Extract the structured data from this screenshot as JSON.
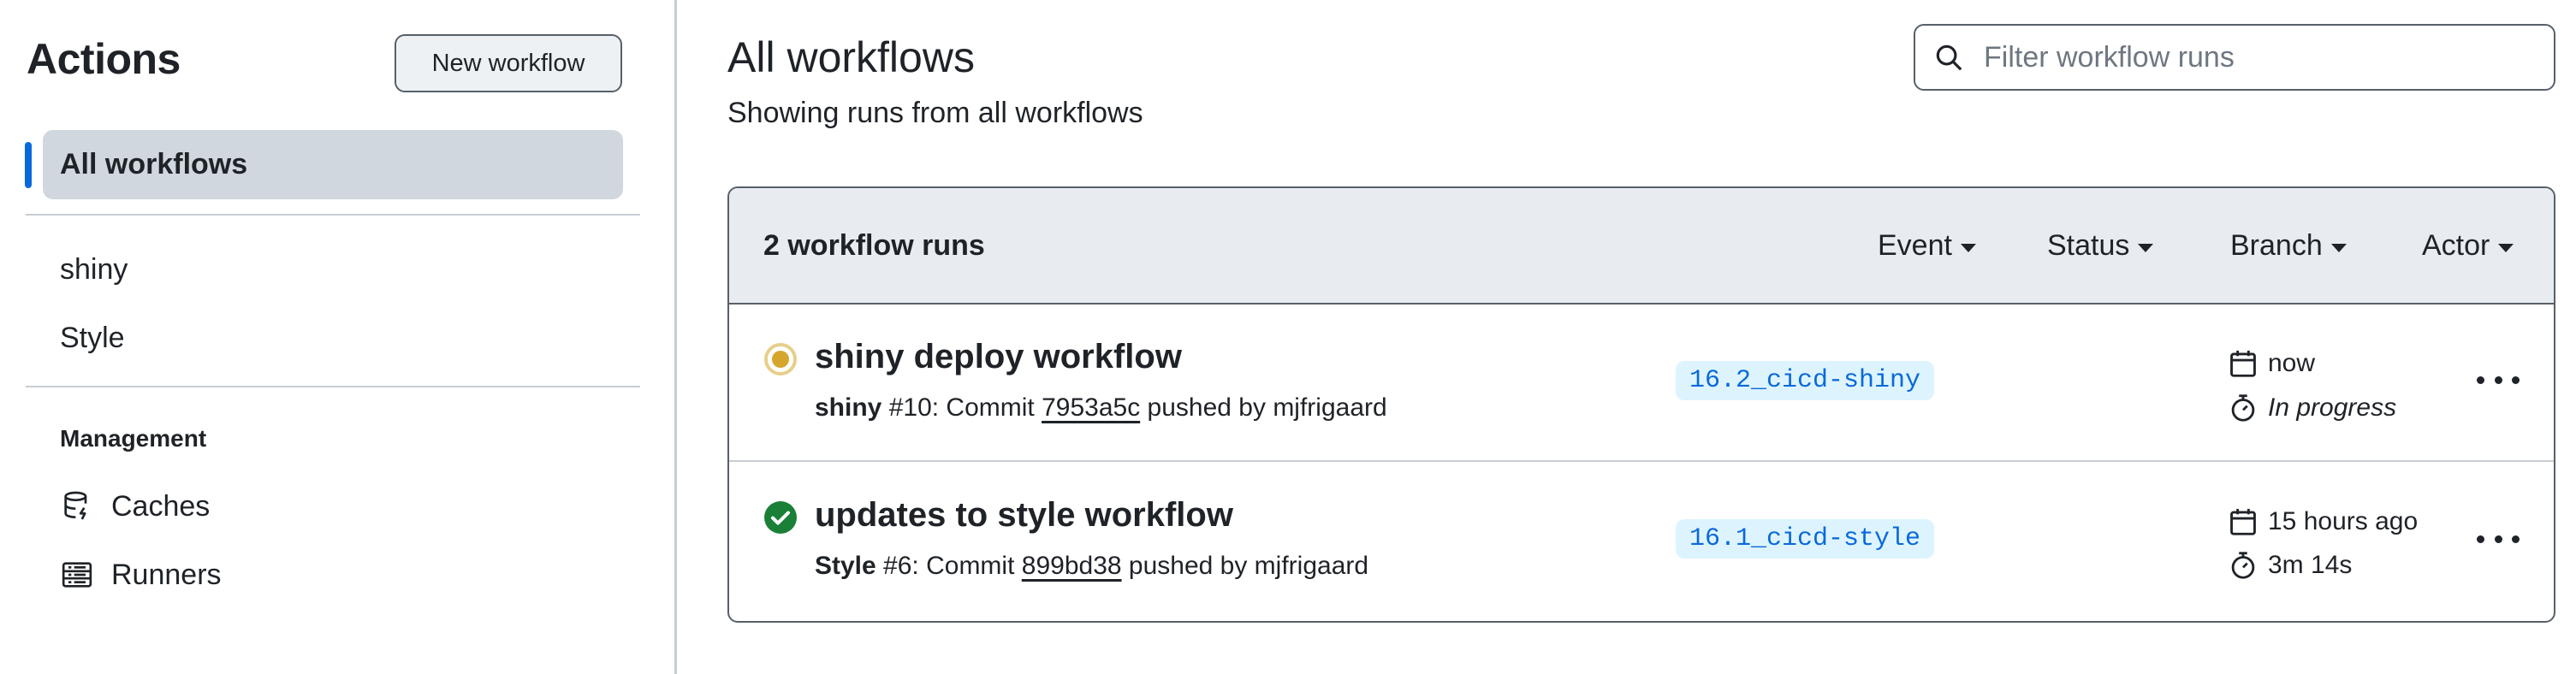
{
  "sidebar": {
    "title": "Actions",
    "new_workflow_label": "New workflow",
    "active_item": "All workflows",
    "workflows": [
      "shiny",
      "Style"
    ],
    "management_label": "Management",
    "management_items": [
      {
        "label": "Caches",
        "icon": "database-icon"
      },
      {
        "label": "Runners",
        "icon": "server-icon"
      }
    ]
  },
  "main": {
    "title": "All workflows",
    "subtitle": "Showing runs from all workflows",
    "search_placeholder": "Filter workflow runs",
    "runs_count": "2 workflow runs",
    "filters": [
      "Event",
      "Status",
      "Branch",
      "Actor"
    ],
    "runs": [
      {
        "status": "in-progress",
        "title": "shiny deploy workflow",
        "workflow": "shiny",
        "meta_mid": " #10: Commit ",
        "sha": "7953a5c",
        "meta_end": " pushed by mjfrigaard",
        "branch": "16.2_cicd-shiny",
        "when": "now",
        "duration": "In progress"
      },
      {
        "status": "success",
        "title": "updates to style workflow",
        "workflow": "Style",
        "meta_mid": " #6: Commit ",
        "sha": "899bd38",
        "meta_end": " pushed by mjfrigaard",
        "branch": "16.1_cicd-style",
        "when": "15 hours ago",
        "duration": "3m 14s"
      }
    ]
  },
  "colors": {
    "accent": "#0969da",
    "in_progress": "#d4a72c",
    "success": "#1a7f37",
    "header_bg": "#e8ecf0"
  }
}
